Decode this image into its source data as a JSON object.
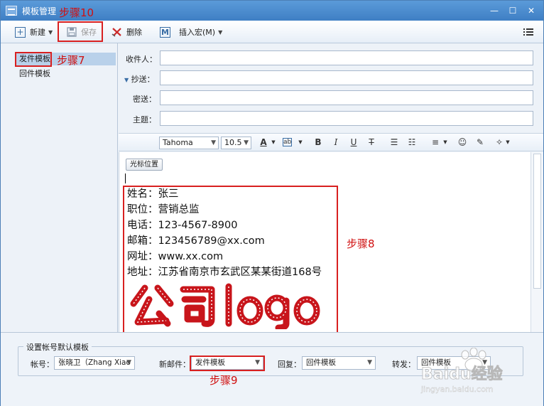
{
  "window": {
    "title": "模板管理",
    "min": "—",
    "max": "☐",
    "close": "✕"
  },
  "annotations": {
    "step10": "步骤10",
    "step7": "步骤7",
    "step8": "步骤8",
    "step9": "步骤9"
  },
  "toolbar": {
    "new_label": "新建",
    "save_label": "保存",
    "delete_label": "删除",
    "insert_macro_label": "插入宏(M)"
  },
  "sidebar": {
    "items": [
      {
        "label": "发件模板",
        "selected": true
      },
      {
        "label": "回件模板",
        "selected": false
      }
    ]
  },
  "compose": {
    "to_label": "收件人：",
    "cc_label": "抄送：",
    "bcc_label": "密送：",
    "subject_label": "主题：",
    "to_value": "",
    "cc_value": "",
    "bcc_value": "",
    "subject_value": ""
  },
  "format": {
    "font": "Tahoma",
    "size": "10.5"
  },
  "editor": {
    "cursor_button": "光标位置",
    "signature": [
      "姓名：张三",
      "职位：营销总监",
      "电话：123-4567-8900",
      "邮箱：123456789@xx.com",
      "网址：www.xx.com",
      "地址：江苏省南京市玄武区某某街道168号"
    ],
    "logo_text": "公司logo"
  },
  "defaults": {
    "group_title": "设置帐号默认模板",
    "account_label": "帐号：",
    "account_value": "张晓卫（Zhang Xiao",
    "new_mail_label": "新邮件：",
    "new_mail_value": "发件模板",
    "reply_label": "回复：",
    "reply_value": "回件模板",
    "forward_label": "转发：",
    "forward_value": "回件模板"
  },
  "watermark": {
    "text": "Baidu经验",
    "url": "jingyan.baidu.com"
  },
  "colors": {
    "accent": "#3f7fc4",
    "annotation": "#d01010",
    "logo": "#c8151b"
  }
}
